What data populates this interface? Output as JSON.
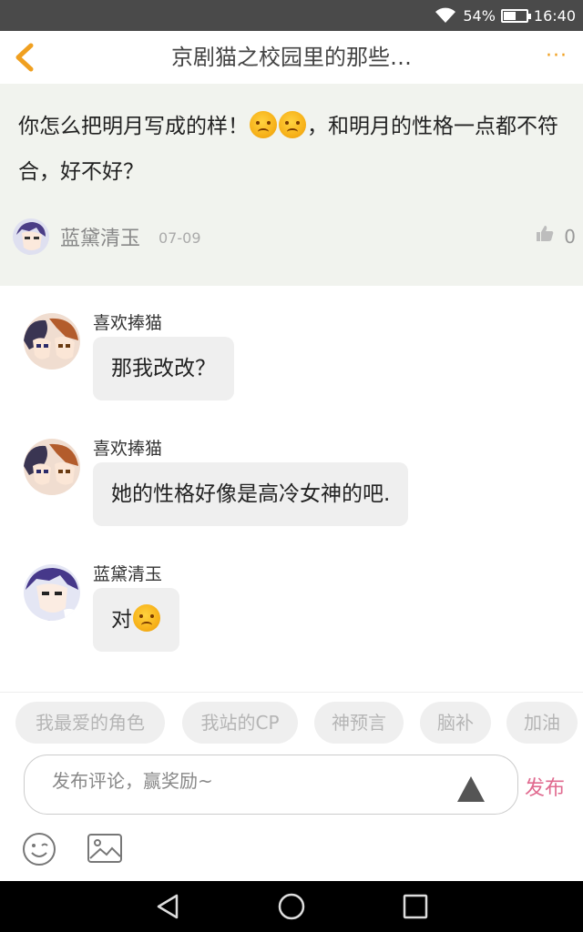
{
  "status_bar": {
    "battery": "54%",
    "time": "16:40",
    "battery_level": 0.54
  },
  "header": {
    "title": "京剧猫之校园里的那些…",
    "more": "···"
  },
  "main_comment": {
    "text_before": "你怎么把明月写成的样！",
    "text_after": "，和明月的性格一点都不符合，好不好？",
    "author": "蓝黛清玉",
    "date": "07-09",
    "likes": "0"
  },
  "replies": [
    {
      "name": "喜欢捧猫",
      "text": "那我改改？",
      "emoji": false
    },
    {
      "name": "喜欢捧猫",
      "text": "她的性格好像是高冷女神的吧.",
      "emoji": false
    },
    {
      "name": "蓝黛清玉",
      "text": "对",
      "emoji": true
    }
  ],
  "tags": [
    "我最爱的角色",
    "我站的CP",
    "神预言",
    "脑补",
    "加油"
  ],
  "input": {
    "placeholder": "发布评论，赢奖励~",
    "publish_label": "发布"
  },
  "colors": {
    "accent_orange": "#f0a020",
    "publish_pink": "#e06a8f",
    "comment_bg": "#f1f3ee"
  }
}
